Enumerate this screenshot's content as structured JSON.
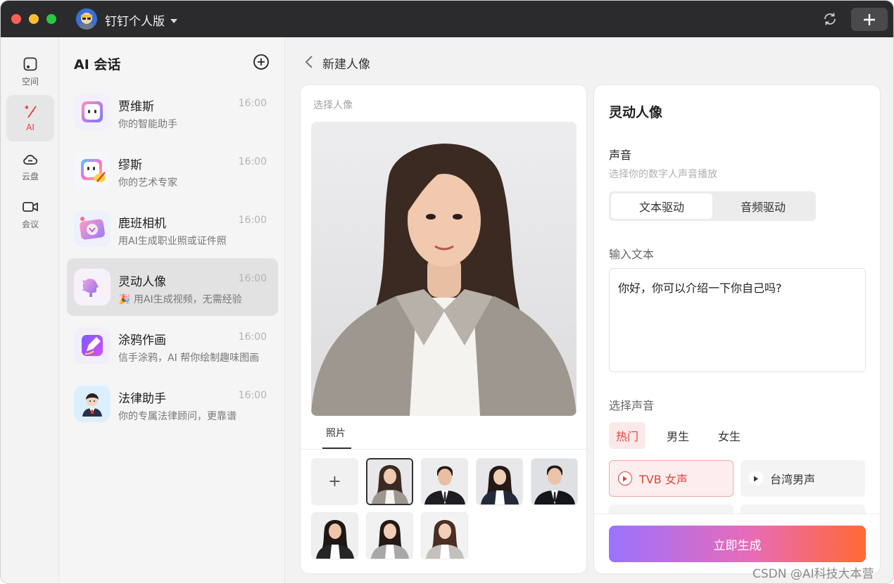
{
  "window": {
    "app_title": "钉钉个人版"
  },
  "rail": {
    "items": [
      {
        "label": "空间",
        "icon": "space-icon"
      },
      {
        "label": "AI",
        "icon": "magic-wand-icon",
        "active": true
      },
      {
        "label": "云盘",
        "icon": "cloud-icon"
      },
      {
        "label": "会议",
        "icon": "video-icon"
      }
    ]
  },
  "sessions": {
    "title": "AI 会话",
    "items": [
      {
        "name": "贾维斯",
        "time": "16:00",
        "subtitle": "你的智能助手"
      },
      {
        "name": "缪斯",
        "time": "16:00",
        "subtitle": "你的艺术专家"
      },
      {
        "name": "鹿班相机",
        "time": "16:00",
        "subtitle": "用AI生成职业照或证件照"
      },
      {
        "name": "灵动人像",
        "time": "16:00",
        "subtitle": "🎉 用AI生成视频，无需经验",
        "active": true
      },
      {
        "name": "涂鸦作画",
        "time": "16:00",
        "subtitle": "信手涂鸦，AI 帮你绘制趣味图画"
      },
      {
        "name": "法律助手",
        "time": "16:00",
        "subtitle": "你的专属法律顾问，更靠谱"
      }
    ]
  },
  "main": {
    "title": "新建人像",
    "left": {
      "label": "选择人像",
      "tab": "照片",
      "add": "+"
    },
    "right": {
      "title": "灵动人像",
      "voice_title": "声音",
      "voice_sub": "选择你的数字人声音播放",
      "segments": [
        "文本驱动",
        "音频驱动"
      ],
      "input_label": "输入文本",
      "input_text": "你好，你可以介绍一下你自己吗?",
      "pick_label": "选择声音",
      "voice_tabs": [
        "热门",
        "男生",
        "女生"
      ],
      "voices": [
        "TVB 女声",
        "台湾男声"
      ],
      "generate": "立即生成"
    }
  },
  "watermark": "CSDN @AI科技大本营",
  "colors": {
    "accent": "#e0413a",
    "gradient_start": "#9b72ff",
    "gradient_end": "#ff6a33"
  }
}
